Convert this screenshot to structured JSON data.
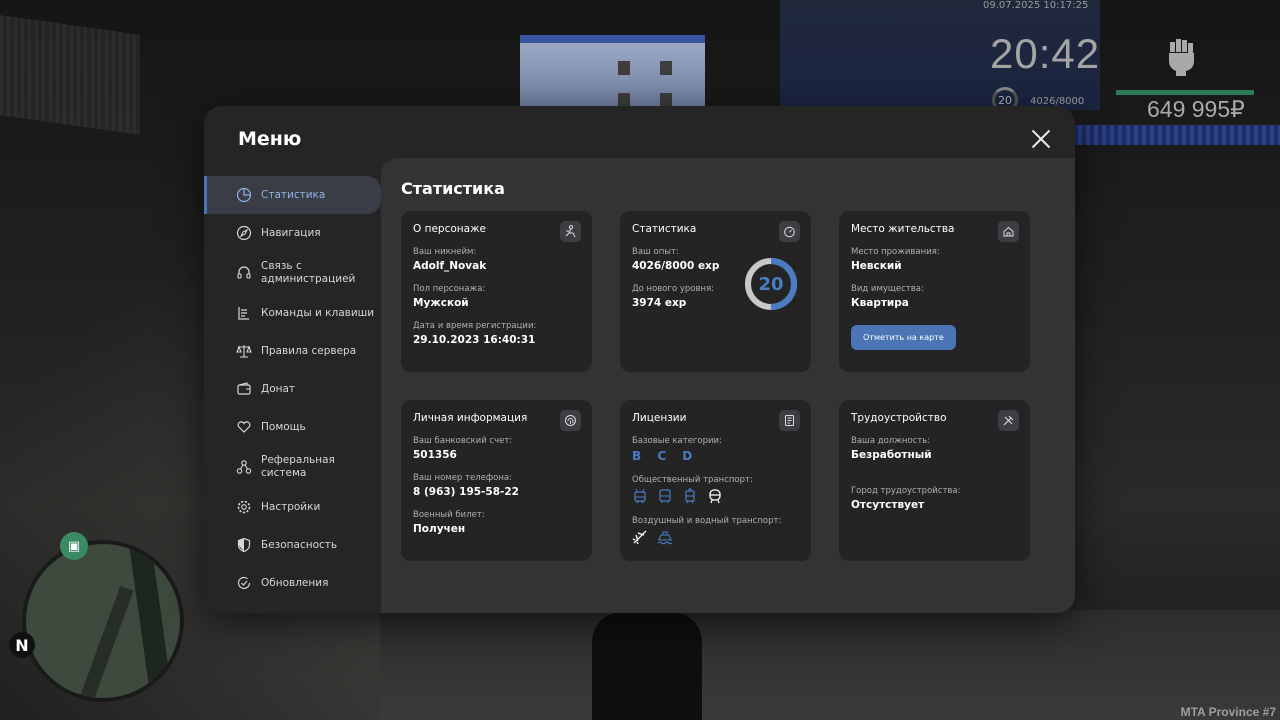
{
  "hud": {
    "datetime": "09.07.2025 10:17:25",
    "clock": "20:42",
    "level": "20",
    "exp": "4026/8000",
    "money": "649 995₽",
    "server": "MTA Province #7",
    "minimap_north": "N",
    "health_color": "#2a7a55"
  },
  "menu": {
    "title": "Меню",
    "sidebar": [
      {
        "label": "Статистика",
        "icon": "pie-chart-icon"
      },
      {
        "label": "Навигация",
        "icon": "compass-icon"
      },
      {
        "label": "Связь с администрацией",
        "icon": "headset-icon"
      },
      {
        "label": "Команды и клавиши",
        "icon": "keyboard-icon"
      },
      {
        "label": "Правила сервера",
        "icon": "scales-icon"
      },
      {
        "label": "Донат",
        "icon": "wallet-icon"
      },
      {
        "label": "Помощь",
        "icon": "heart-hand-icon"
      },
      {
        "label": "Реферальная система",
        "icon": "network-icon"
      },
      {
        "label": "Настройки",
        "icon": "gear-icon"
      },
      {
        "label": "Безопасность",
        "icon": "shield-icon"
      },
      {
        "label": "Обновления",
        "icon": "refresh-check-icon"
      }
    ]
  },
  "content": {
    "title": "Статистика",
    "character": {
      "title": "О персонаже",
      "nickname_label": "Ваш никнейм:",
      "nickname": "Adolf_Novak",
      "gender_label": "Пол персонажа:",
      "gender": "Мужской",
      "reg_label": "Дата и время регистрации:",
      "reg": "29.10.2023 16:40:31"
    },
    "stats": {
      "title": "Статистика",
      "exp_label": "Ваш опыт:",
      "exp": "4026/8000 exp",
      "next_label": "До нового уровня:",
      "next": "3974 exp",
      "level": "20",
      "progress": 0.5
    },
    "residence": {
      "title": "Место жительства",
      "place_label": "Место проживания:",
      "place": "Невский",
      "type_label": "Вид имущества:",
      "type": "Квартира",
      "button": "Отметить на карте"
    },
    "personal": {
      "title": "Личная информация",
      "bank_label": "Ваш банковский счет:",
      "bank": "501356",
      "phone_label": "Ваш номер телефона:",
      "phone": "8 (963) 195-58-22",
      "military_label": "Военный билет:",
      "military": "Получен"
    },
    "licenses": {
      "title": "Лицензии",
      "basic_label": "Базовые категории:",
      "basic": "B C D",
      "public_label": "Общественный транспорт:",
      "air_label": "Воздушный и водный транспорт:"
    },
    "employment": {
      "title": "Трудоустройство",
      "position_label": "Ваша должность:",
      "position": "Безработный",
      "city_label": "Город трудоустройства:",
      "city": "Отсутствует"
    }
  },
  "colors": {
    "accent": "#4b7bc2",
    "panel": "#242425",
    "content_bg": "#333335",
    "window_bg": "#252526"
  }
}
